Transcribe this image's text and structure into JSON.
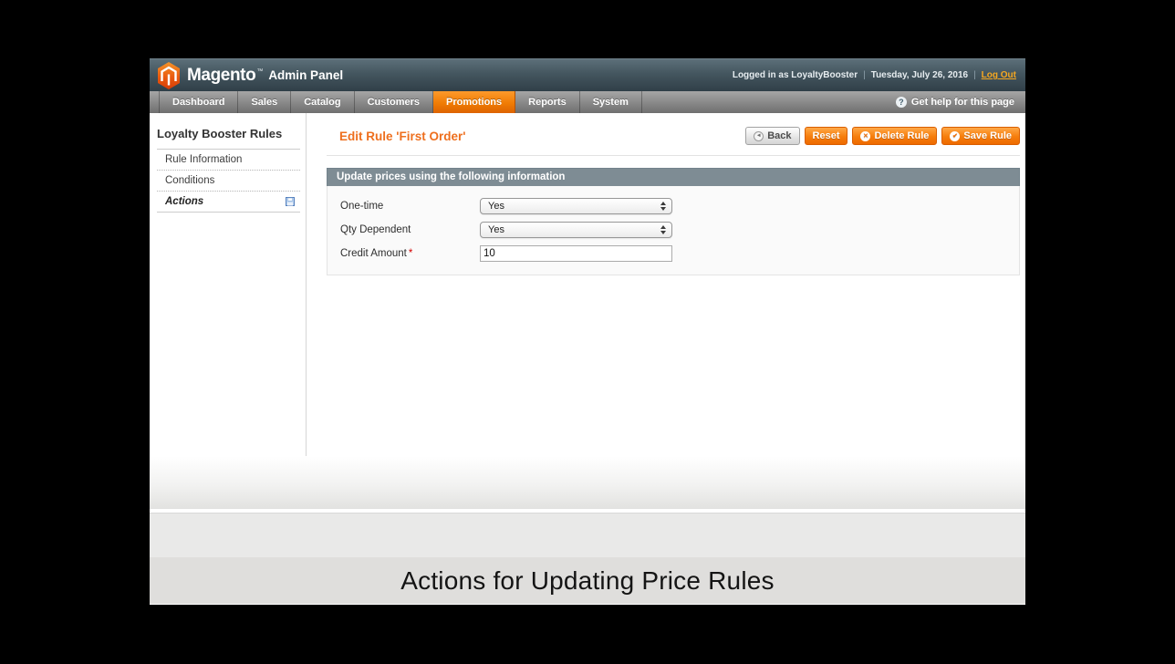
{
  "header": {
    "brand": "Magento",
    "brand_tm": "™",
    "brand_suffix": "Admin Panel",
    "logged_in_as": "Logged in as LoyaltyBooster",
    "sep": "|",
    "date": "Tuesday, July 26, 2016",
    "logout_label": "Log Out"
  },
  "nav": {
    "tabs": [
      {
        "label": "Dashboard",
        "active": false
      },
      {
        "label": "Sales",
        "active": false
      },
      {
        "label": "Catalog",
        "active": false
      },
      {
        "label": "Customers",
        "active": false
      },
      {
        "label": "Promotions",
        "active": true
      },
      {
        "label": "Reports",
        "active": false
      },
      {
        "label": "System",
        "active": false
      }
    ],
    "help_label": "Get help for this page"
  },
  "sidebar": {
    "title": "Loyalty Booster Rules",
    "items": [
      {
        "label": "Rule Information",
        "active": false
      },
      {
        "label": "Conditions",
        "active": false
      },
      {
        "label": "Actions",
        "active": true
      }
    ]
  },
  "main": {
    "page_title": "Edit Rule 'First Order'",
    "buttons": {
      "back": "Back",
      "reset": "Reset",
      "delete": "Delete Rule",
      "save": "Save Rule"
    },
    "section": {
      "header": "Update prices using the following information",
      "fields": [
        {
          "label": "One-time",
          "type": "select",
          "value": "Yes",
          "required": false
        },
        {
          "label": "Qty Dependent",
          "type": "select",
          "value": "Yes",
          "required": false
        },
        {
          "label": "Credit Amount",
          "type": "text",
          "value": "10",
          "required": true,
          "required_mark": "*"
        }
      ]
    }
  },
  "caption": "Actions for Updating Price Rules",
  "icons": {
    "help_glyph": "?",
    "back_glyph": "◄",
    "delete_glyph": "✕",
    "save_glyph": "✔"
  },
  "colors": {
    "accent_orange": "#ee6a00",
    "header_gradient_top": "#5c6f79",
    "header_gradient_bottom": "#303f48",
    "nav_active_orange": "#f07c05",
    "section_header_bg": "#7e8c94",
    "required_red": "#d40000",
    "caption_band_bg": "#dfdedc"
  }
}
